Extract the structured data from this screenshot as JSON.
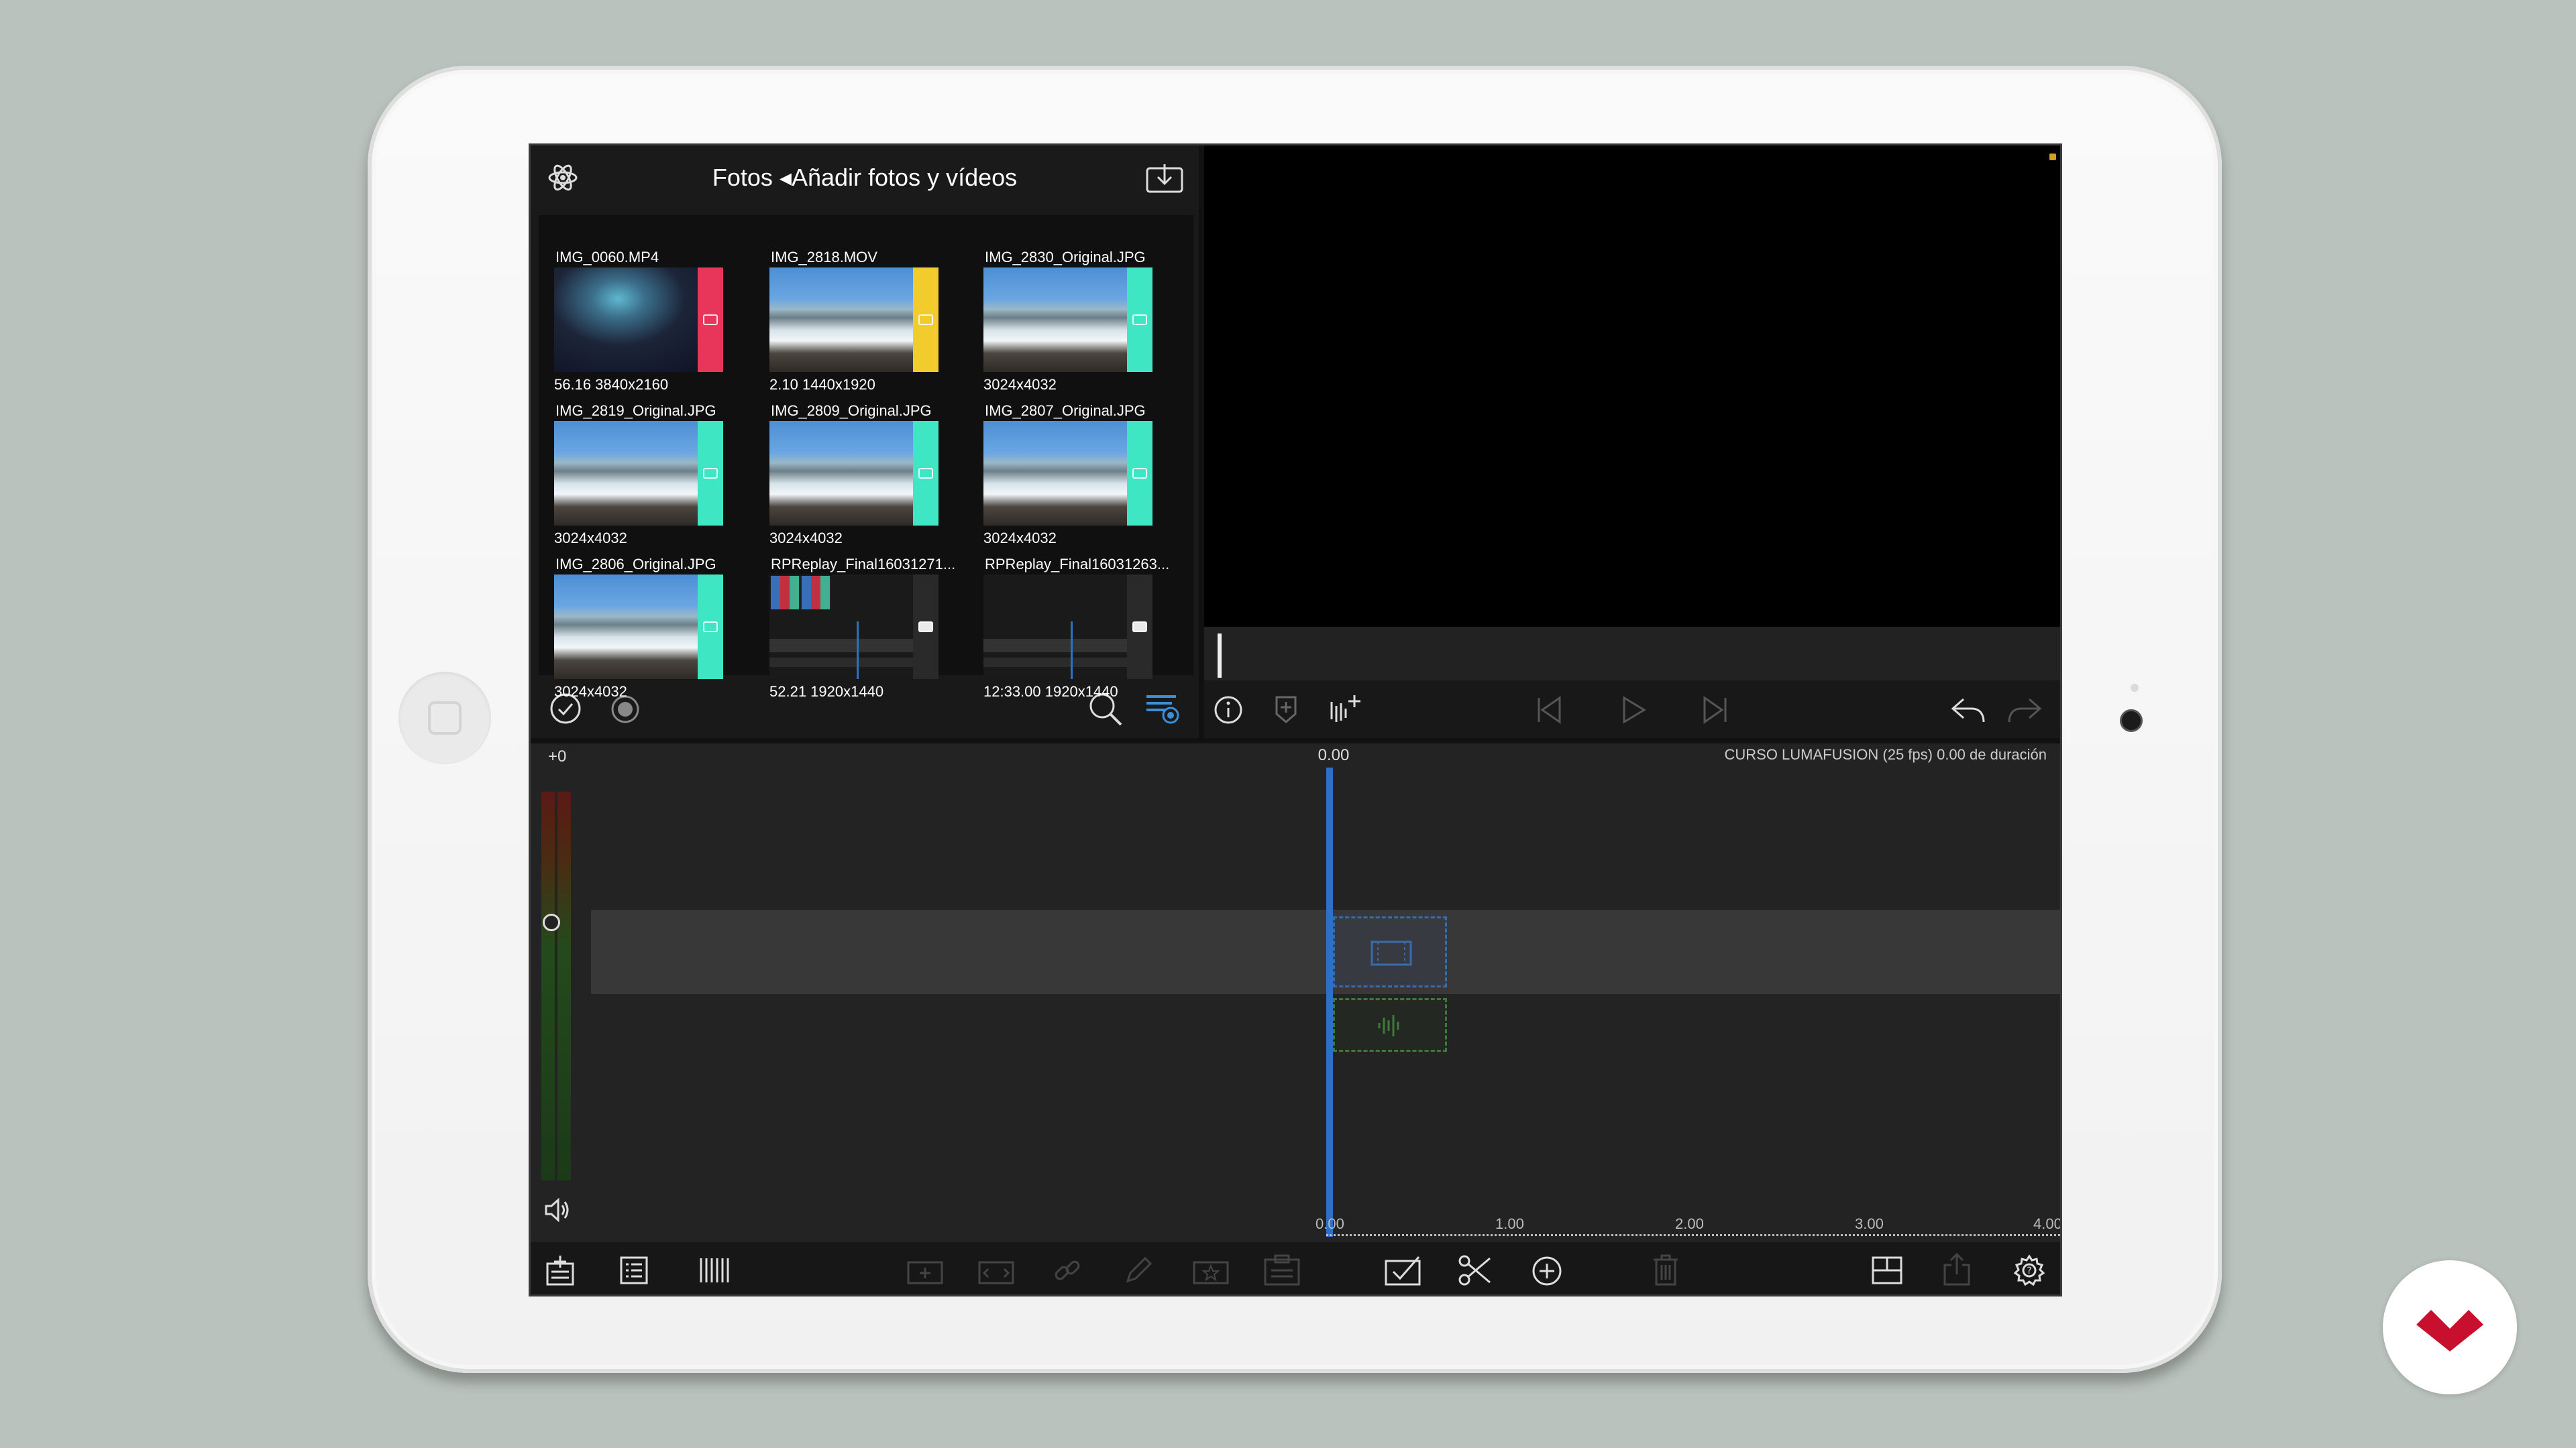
{
  "media_browser": {
    "title": "Fotos ◂Añadir fotos y vídeos",
    "atom_icon": "atom-icon",
    "import_icon": "import-icon",
    "items": [
      {
        "name": "IMG_0060.MP4",
        "meta": "56.16  3840x2160",
        "badge_color": "#e8365a",
        "badge_icon": "video-clip-icon"
      },
      {
        "name": "IMG_2818.MOV",
        "meta": "2.10  1440x1920",
        "badge_color": "#f2cc2c",
        "badge_icon": "video-clip-icon"
      },
      {
        "name": "IMG_2830_Original.JPG",
        "meta": "3024x4032",
        "badge_color": "#3ee6c3",
        "badge_icon": "photo-icon"
      },
      {
        "name": "IMG_2819_Original.JPG",
        "meta": "3024x4032",
        "badge_color": "#3ee6c3",
        "badge_icon": "photo-icon"
      },
      {
        "name": "IMG_2809_Original.JPG",
        "meta": "3024x4032",
        "badge_color": "#3ee6c3",
        "badge_icon": "photo-icon"
      },
      {
        "name": "IMG_2807_Original.JPG",
        "meta": "3024x4032",
        "badge_color": "#3ee6c3",
        "badge_icon": "photo-icon"
      },
      {
        "name": "IMG_2806_Original.JPG",
        "meta": "3024x4032",
        "badge_color": "#3ee6c3",
        "badge_icon": "photo-icon"
      },
      {
        "name": "RPReplay_Final16031271...",
        "meta": "52.21  1920x1440",
        "badge_color": "#2a2a2a",
        "badge_icon": "video-clip-icon"
      },
      {
        "name": "RPReplay_Final16031263...",
        "meta": "12:33.00  1920x1440",
        "badge_color": "#2a2a2a",
        "badge_icon": "video-clip-icon"
      }
    ],
    "toolbar": {
      "select_icon": "check-circle-icon",
      "record_icon": "record-icon",
      "search_icon": "search-icon",
      "sort_icon": "sort-filter-icon"
    }
  },
  "viewer": {
    "toolbar": [
      "info-icon",
      "marker-icon",
      "audio-add-icon",
      "skip-back-icon",
      "play-icon",
      "skip-forward-icon",
      "undo-icon",
      "redo-icon"
    ]
  },
  "timeline": {
    "level_label": "+0",
    "playhead_time": "0.00",
    "project_info": "CURSO LUMAFUSION (25 fps) 0.00 de duración",
    "ruler": [
      "0.00",
      "1.00",
      "2.00",
      "3.00",
      "4.00"
    ],
    "colors": {
      "playhead": "#2f6fc8",
      "video_clip_outline": "#3d6aa8",
      "audio_clip_outline": "#3e7a3a"
    }
  },
  "bottom_toolbar": {
    "left": [
      "add-track-icon",
      "list-view-icon",
      "track-height-icon"
    ],
    "middle_disabled": [
      "add-clip-icon",
      "split-clip-icon",
      "link-icon",
      "edit-pencil-icon",
      "favorite-icon",
      "paste-icon"
    ],
    "edit": [
      "select-check-icon",
      "scissors-icon",
      "add-circle-icon",
      "trash-icon"
    ],
    "right": [
      "layout-icon",
      "share-icon",
      "settings-gear-icon"
    ]
  },
  "brand": {
    "logo_color": "#c8102e"
  }
}
